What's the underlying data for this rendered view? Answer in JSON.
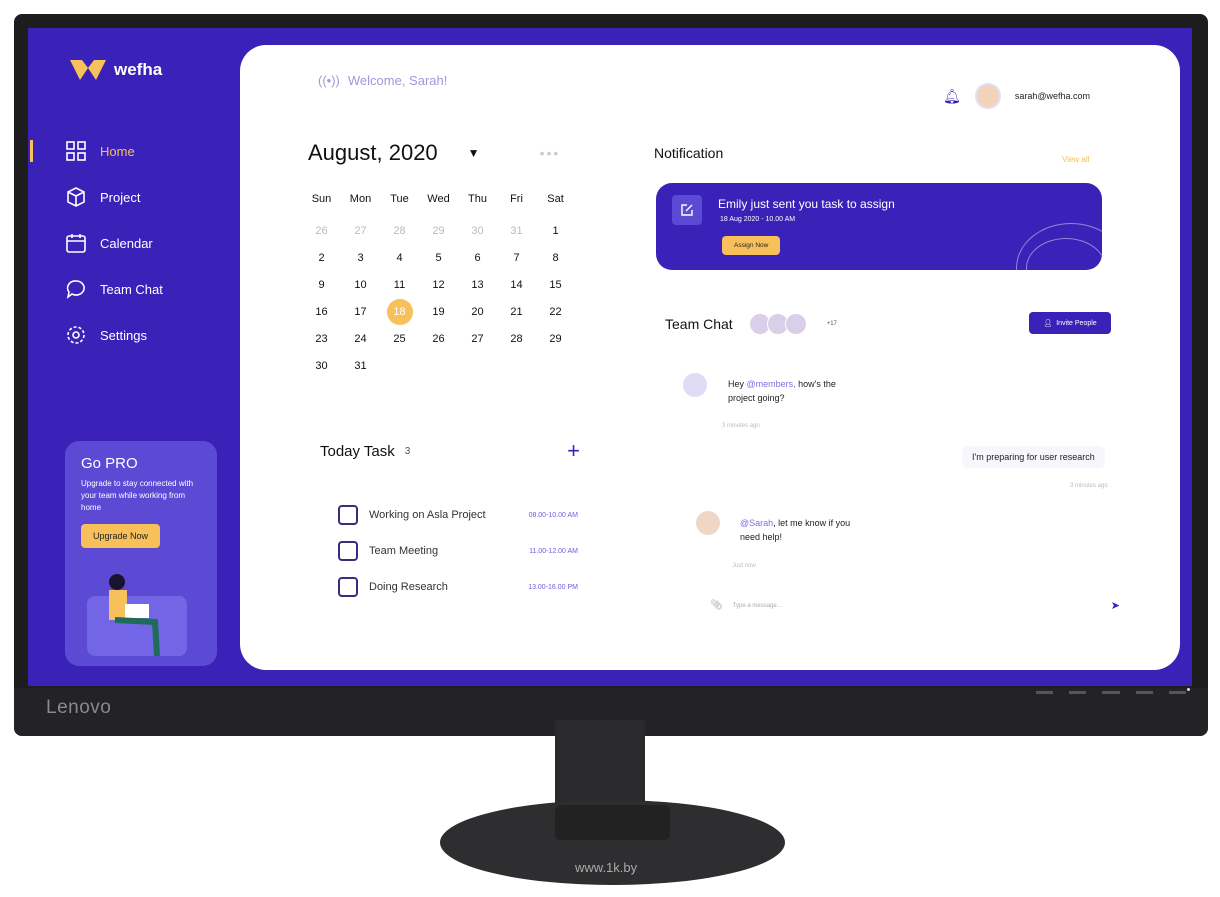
{
  "brand": "Lenovo",
  "app": {
    "name": "wefha",
    "accent": "#3a22b8",
    "highlight": "#f7c05a"
  },
  "sidebar": {
    "items": [
      {
        "label": "Home",
        "icon": "grid-icon",
        "active": true
      },
      {
        "label": "Project",
        "icon": "cube-icon"
      },
      {
        "label": "Calendar",
        "icon": "calendar-icon"
      },
      {
        "label": "Team Chat",
        "icon": "chat-icon"
      },
      {
        "label": "Settings",
        "icon": "gear-icon"
      }
    ]
  },
  "promo": {
    "title": "Go PRO",
    "text": "Upgrade to stay connected with your team while working from home",
    "button": "Upgrade Now"
  },
  "header": {
    "welcome": "Welcome, Sarah!",
    "email": "sarah@wefha.com"
  },
  "calendar": {
    "month": "August, 2020",
    "weekdays": [
      "Sun",
      "Mon",
      "Tue",
      "Wed",
      "Thu",
      "Fri",
      "Sat"
    ],
    "prev_month_days": [
      "26",
      "27",
      "28",
      "29",
      "30",
      "31"
    ],
    "days": [
      "1",
      "2",
      "3",
      "4",
      "5",
      "6",
      "7",
      "8",
      "9",
      "10",
      "11",
      "12",
      "13",
      "14",
      "15",
      "16",
      "17",
      "18",
      "19",
      "20",
      "21",
      "22",
      "23",
      "24",
      "25",
      "26",
      "27",
      "28",
      "29",
      "30",
      "31"
    ],
    "selected": "18"
  },
  "tasks": {
    "title": "Today Task",
    "count": "3",
    "items": [
      {
        "label": "Working on Asla Project",
        "time": "08.00-10.00 AM"
      },
      {
        "label": "Team Meeting",
        "time": "11.00-12.00 AM"
      },
      {
        "label": "Doing Research",
        "time": "13.00-16.00 PM"
      }
    ]
  },
  "notification": {
    "title": "Notification",
    "view_all": "View all",
    "message": "Emily just sent you task to assign",
    "date": "18 Aug 2020 - 10.00 AM",
    "button": "Assign Now"
  },
  "chat": {
    "title": "Team Chat",
    "more_members": "+17",
    "invite": "Invite People",
    "messages": [
      {
        "pre": "Hey ",
        "mention": "@members,",
        "post": " how's the project going?",
        "time": "3 minutes ago"
      },
      {
        "text": "I'm preparing for user research",
        "time": "3 minutes ago"
      },
      {
        "mention": "@Sarah",
        "post": ", let me know if you need help!",
        "time": "Just now"
      }
    ],
    "placeholder": "Type a message..."
  },
  "watermark": "www.1k.by"
}
